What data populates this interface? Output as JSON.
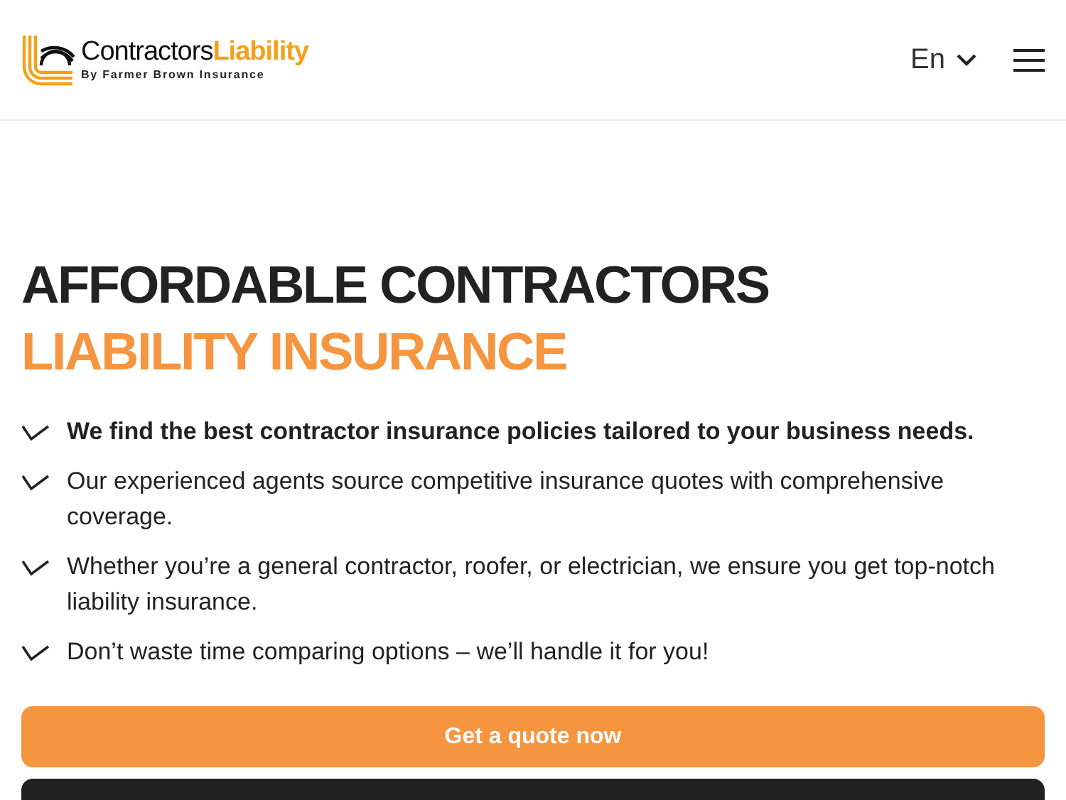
{
  "header": {
    "logo": {
      "name_dark": "Contractors",
      "name_accent": "Liability",
      "tagline": "By Farmer Brown Insurance"
    },
    "language": "En"
  },
  "hero": {
    "title_line_1": "AFFORDABLE CONTRACTORS",
    "title_line_2": "LIABILITY INSURANCE",
    "points": [
      {
        "text": "We find the best contractor insurance policies tailored to your business needs.",
        "emphasis": true
      },
      {
        "text": "Our experienced agents source competitive insurance quotes with comprehensive coverage.",
        "emphasis": false
      },
      {
        "text": "Whether you’re a general contractor, roofer, or electrician, we ensure you get top-notch liability insurance.",
        "emphasis": false
      },
      {
        "text": "Don’t waste time comparing options – we’ll handle it for you!",
        "emphasis": false
      }
    ],
    "cta": "Get a quote now"
  }
}
